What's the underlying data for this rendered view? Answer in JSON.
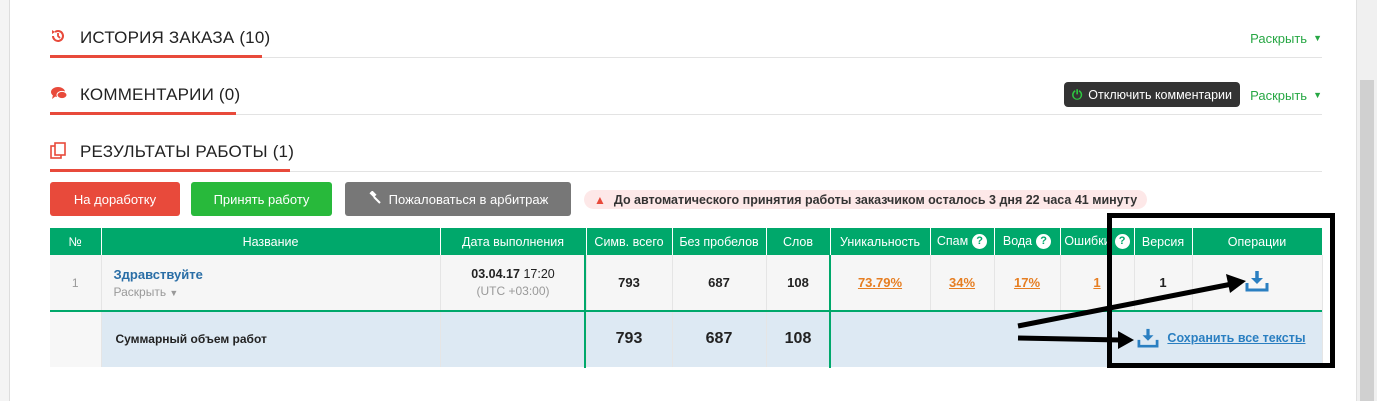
{
  "sections": {
    "history": {
      "title": "ИСТОРИЯ ЗАКАЗА (10)",
      "expand": "Раскрыть",
      "icon": "history-icon"
    },
    "comments": {
      "title": "КОММЕНТАРИИ (0)",
      "expand": "Раскрыть",
      "icon": "comments-icon",
      "toggle": "Отключить комментарии"
    },
    "results": {
      "title": "РЕЗУЛЬТАТЫ РАБОТЫ (1)",
      "icon": "copy-icon"
    }
  },
  "actions": {
    "rework": "На доработку",
    "accept": "Принять работу",
    "arbitrage": "Пожаловаться в арбитраж",
    "warning": "До автоматического принятия работы заказчиком осталось 3 дня 22 часа 41 минуту"
  },
  "table": {
    "headers": [
      "№",
      "Название",
      "Дата выполнения",
      "Симв. всего",
      "Без пробелов",
      "Слов",
      "Уникальность",
      "Спам",
      "Вода",
      "Ошибки",
      "Версия",
      "Операции"
    ],
    "row": {
      "num": "1",
      "title": "Здравствуйте",
      "expand": "Раскрыть",
      "date": "03.04.17",
      "time": "17:20",
      "tz": "(UTC +03:00)",
      "chars": "793",
      "no_spaces": "687",
      "words": "108",
      "uniqueness": "73.79%",
      "spam": "34%",
      "water": "17%",
      "errors": "1",
      "version": "1"
    },
    "total": {
      "label": "Суммарный объем работ",
      "chars": "793",
      "no_spaces": "687",
      "words": "108",
      "save_all": "Сохранить все тексты"
    }
  },
  "colors": {
    "accent_red": "#e84a3b",
    "green": "#00a86b",
    "link_blue": "#2a6ea6",
    "orange": "#e67e22"
  }
}
